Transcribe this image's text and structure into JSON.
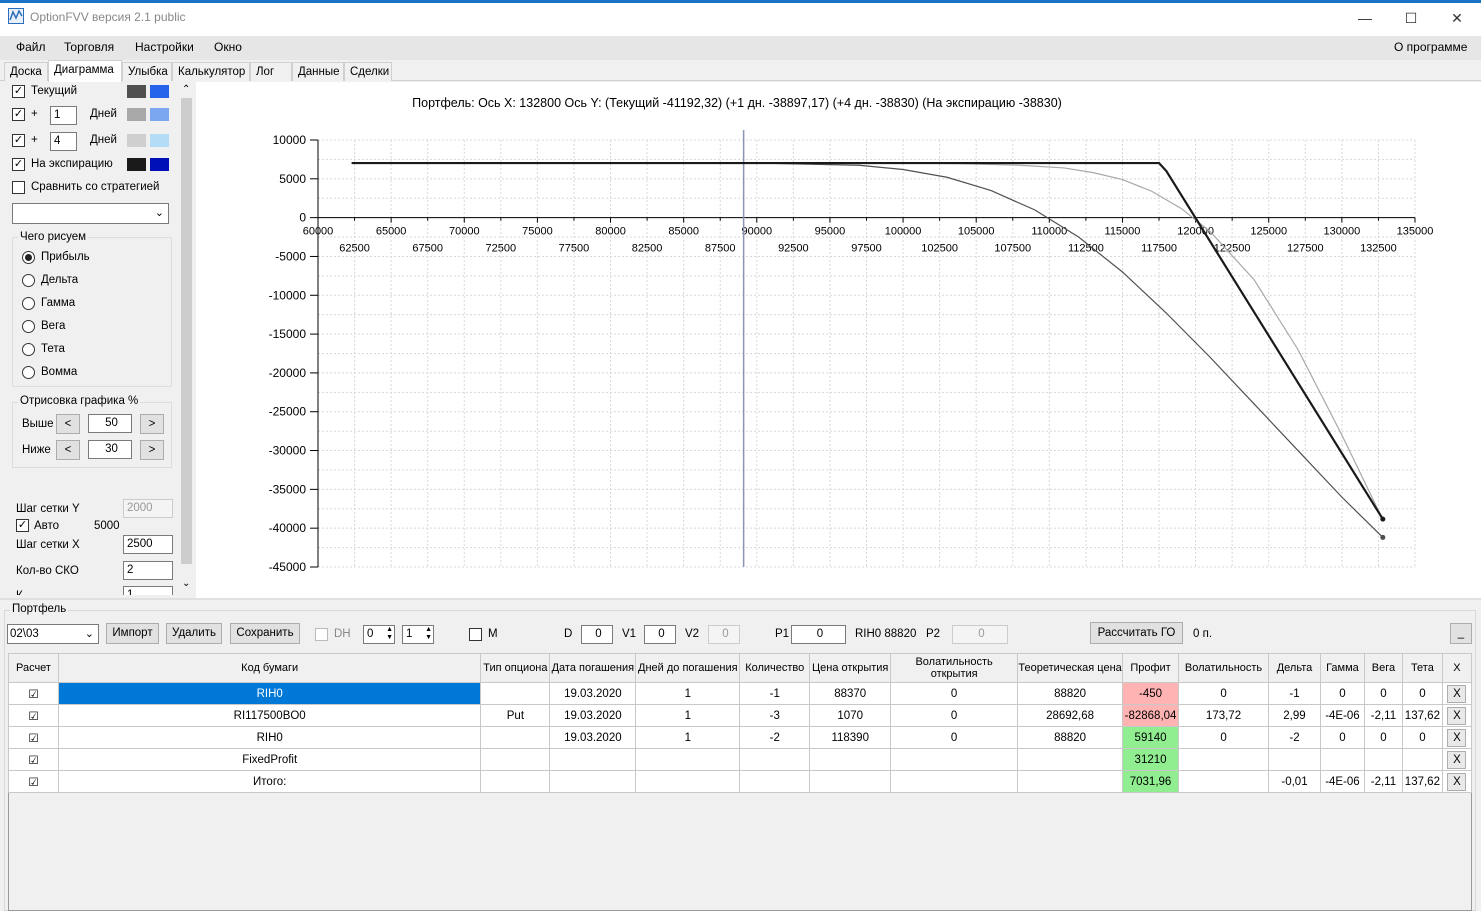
{
  "window": {
    "title": "OptionFVV версия 2.1 public",
    "minimize": "—",
    "maximize": "☐",
    "close": "✕"
  },
  "menu": {
    "items": [
      "Файл",
      "Торговля",
      "Настройки",
      "Окно"
    ],
    "about": "О программе"
  },
  "tabs": [
    "Доска",
    "Диаграмма",
    "Улыбка",
    "Калькулятор",
    "Лог",
    "Данные",
    "Сделки"
  ],
  "left": {
    "current_label": "Текущий",
    "plus1_sign": "+",
    "plus1_value": "1",
    "plus1_days": "Дней",
    "plus2_sign": "+",
    "plus2_value": "4",
    "plus2_days": "Дней",
    "expiry_label": "На экспирацию",
    "compare_label": "Сравнить со стратегией",
    "draw_group": "Чего рисуем",
    "radios": [
      "Прибыль",
      "Дельта",
      "Гамма",
      "Вега",
      "Тета",
      "Вомма"
    ],
    "render_group": "Отрисовка графика %",
    "above_label": "Выше",
    "above_value": "50",
    "below_label": "Ниже",
    "below_value": "30",
    "btn_left": "<",
    "btn_right": ">",
    "grid_y_label": "Шаг сетки Y",
    "grid_y_value": "2000",
    "auto_label": "Авто",
    "auto_value": "5000",
    "grid_x_label": "Шаг сетки X",
    "grid_x_value": "2500",
    "sko_label": "Кол-во СКО",
    "sko_value": "2",
    "cut_label": "К",
    "cut_value": "1"
  },
  "colors": {
    "current": [
      "#505050",
      "#2563eb"
    ],
    "plus1": [
      "#a8a8a8",
      "#7aa7f0"
    ],
    "plus2": [
      "#cfcfcf",
      "#b3dcf7"
    ],
    "expiry": [
      "#1a1a1a",
      "#0010b8"
    ]
  },
  "chart_data": {
    "type": "line",
    "title": "Портфель:  Ось X:  132800  Ось Y:   (Текущий -41192,32)  (+1 дн. -38897,17)  (+4 дн. -38830)  (На экспирацию -38830)",
    "xlim": [
      60000,
      135000
    ],
    "ylim": [
      -45000,
      10000
    ],
    "yticks": [
      "10000",
      "5000",
      "0",
      "-5000",
      "-10000",
      "-15000",
      "-20000",
      "-25000",
      "-30000",
      "-35000",
      "-40000",
      "-45000"
    ],
    "xticks_upper": [
      "60000",
      "65000",
      "70000",
      "75000",
      "80000",
      "85000",
      "90000",
      "95000",
      "100000",
      "105000",
      "110000",
      "115000",
      "120000",
      "125000",
      "130000",
      "135000"
    ],
    "xticks_lower": [
      "62500",
      "67500",
      "72500",
      "77500",
      "82500",
      "87500",
      "92500",
      "97500",
      "102500",
      "107500",
      "112500",
      "117500",
      "122500",
      "127500",
      "132500"
    ],
    "current_price_marker": 89100,
    "series": [
      {
        "x": [
          62300,
          90000,
          97000,
          100000,
          103000,
          106000,
          109000,
          112000,
          115000,
          118000,
          121000,
          124000,
          127000,
          130000,
          132800
        ],
        "y": [
          7032,
          7032,
          6750,
          6200,
          5200,
          3500,
          1000,
          -2500,
          -7000,
          -12300,
          -18000,
          -24000,
          -30000,
          -36000,
          -41192
        ]
      },
      {
        "x": [
          62300,
          100000,
          104000,
          108000,
          111000,
          113000,
          115000,
          117000,
          119000,
          121000,
          124000,
          127000,
          130000,
          132800
        ],
        "y": [
          7032,
          7032,
          6950,
          6750,
          6400,
          5800,
          4900,
          3400,
          1200,
          -1800,
          -8000,
          -17000,
          -28000,
          -38897
        ]
      },
      {
        "x": [
          62300,
          117500,
          118000,
          132800
        ],
        "y": [
          7032,
          7032,
          6000,
          -38830
        ]
      }
    ]
  },
  "bottom": {
    "group_label": "Портфель",
    "date_select": "02\\03",
    "import": "Импорт",
    "delete": "Удалить",
    "save": "Сохранить",
    "dh": "DH",
    "dh_v1": "0",
    "dh_v2": "1",
    "m_label": "M",
    "d_label": "D",
    "d_value": "0",
    "v1_label": "V1",
    "v1_value": "0",
    "v2_label": "V2",
    "v2_value": "0",
    "p1_label": "P1",
    "p1_value": "0",
    "rih0_label": "RIH0 88820",
    "p2_label": "P2",
    "p2_value": "0",
    "calc_go": "Рассчитать ГО",
    "go_value": "0 п.",
    "collapse": "_"
  },
  "table": {
    "headers": [
      "Расчет",
      "Код бумаги",
      "Тип опциона",
      "Дата погашения",
      "Дней до погашения",
      "Количество",
      "Цена открытия",
      "Волатильность открытия",
      "Теоретическая цена",
      "Профит",
      "Волатильность",
      "Дельта",
      "Гамма",
      "Вега",
      "Тета",
      "X"
    ],
    "rows": [
      [
        "☑",
        "RIH0",
        "",
        "19.03.2020",
        "1",
        "-1",
        "88370",
        "0",
        "88820",
        "-450",
        "0",
        "-1",
        "0",
        "0",
        "0",
        "X"
      ],
      [
        "☑",
        "RI117500BO0",
        "Put",
        "19.03.2020",
        "1",
        "-3",
        "1070",
        "0",
        "28692,68",
        "-82868,04",
        "173,72",
        "2,99",
        "-4E-06",
        "-2,11",
        "137,62",
        "X"
      ],
      [
        "☑",
        "RIH0",
        "",
        "19.03.2020",
        "1",
        "-2",
        "118390",
        "0",
        "88820",
        "59140",
        "0",
        "-2",
        "0",
        "0",
        "0",
        "X"
      ],
      [
        "☑",
        "FixedProfit",
        "",
        "",
        "",
        "",
        "",
        "",
        "",
        "31210",
        "",
        "",
        "",
        "",
        "",
        "X"
      ],
      [
        "☑",
        "Итого:",
        "",
        "",
        "",
        "",
        "",
        "",
        "",
        "7031,96",
        "",
        "-0,01",
        "-4E-06",
        "-2,11",
        "137,62",
        "X"
      ]
    ]
  }
}
